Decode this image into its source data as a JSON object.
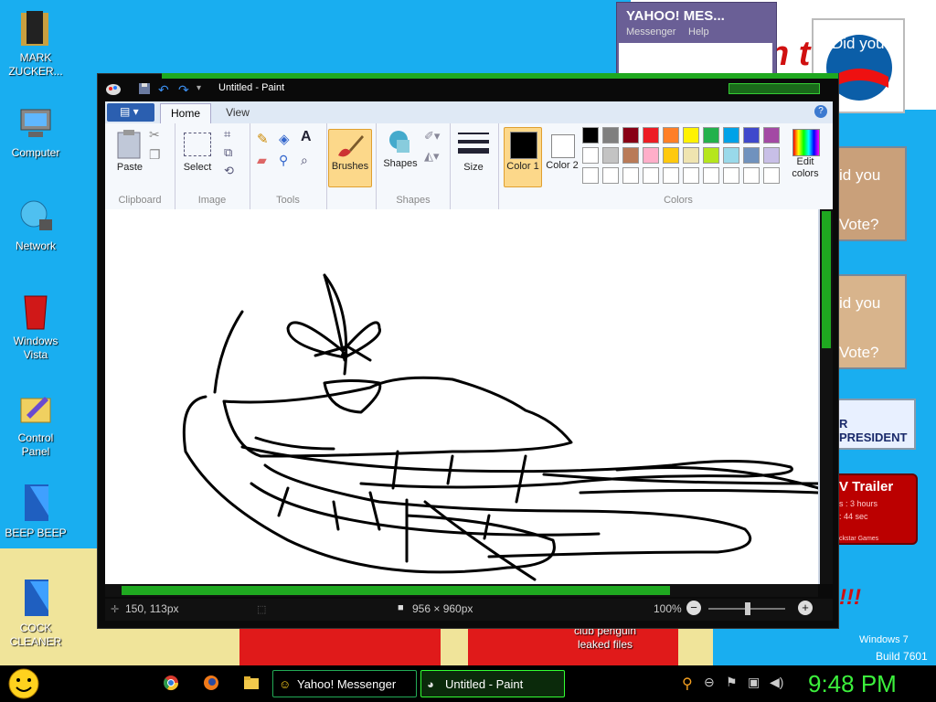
{
  "desktop": {
    "icons": [
      {
        "label": "MARK ZUCKER..."
      },
      {
        "label": "Computer"
      },
      {
        "label": "Network"
      },
      {
        "label": "Windows Vista"
      },
      {
        "label": "Control Panel"
      },
      {
        "label": "BEEP BEEP"
      },
      {
        "label": "COCK CLEANER"
      }
    ],
    "wallpaper_text": {
      "poster": "n t",
      "club_penguin": "club penguin leaked files",
      "windows7": "Windows 7",
      "build": "Build 7601",
      "exclaim": "!!!"
    },
    "widgets": {
      "obama": "Did you",
      "vote1_line1": "id you",
      "vote1_line2": "Vote?",
      "vote2_line1": "id you",
      "vote2_line2": "Vote?",
      "president": "R PRESIDENT",
      "trailer_title": "V Trailer",
      "trailer_line1": "s : 3 hours",
      "trailer_line2": ": 44 sec",
      "trailer_brand": "ckstar Games"
    }
  },
  "yahoo_window": {
    "title": "YAHOO! MES...",
    "menu": [
      "Messenger",
      "Help"
    ]
  },
  "paint": {
    "title": "Untitled - Paint",
    "tabs": [
      "Home",
      "View"
    ],
    "groups": {
      "clipboard": {
        "label": "Clipboard",
        "paste": "Paste"
      },
      "image": {
        "label": "Image",
        "select": "Select"
      },
      "tools": {
        "label": "Tools"
      },
      "brushes": "Brushes",
      "shapes": {
        "label": "Shapes",
        "button": "Shapes"
      },
      "size": "Size",
      "color1": "Color 1",
      "color2": "Color 2",
      "colors": {
        "label": "Colors",
        "edit": "Edit colors"
      }
    },
    "palette_row1": [
      "#000000",
      "#7f7f7f",
      "#880015",
      "#ed1c24",
      "#ff7f27",
      "#fff200",
      "#22b14c",
      "#00a2e8",
      "#3f48cc",
      "#a349a4"
    ],
    "palette_row2": [
      "#ffffff",
      "#c3c3c3",
      "#b97a57",
      "#ffaec9",
      "#ffc90e",
      "#efe4b0",
      "#b5e61d",
      "#99d9ea",
      "#7092be",
      "#c8bfe7"
    ],
    "color1_value": "#000000",
    "color2_value": "#ffffff",
    "status": {
      "cursor": "150, 113px",
      "dimensions": "956 × 960px",
      "zoom": "100%"
    }
  },
  "taskbar": {
    "items": [
      {
        "label": "Yahoo! Messenger"
      },
      {
        "label": "Untitled - Paint"
      }
    ],
    "clock": "9:48 PM"
  }
}
